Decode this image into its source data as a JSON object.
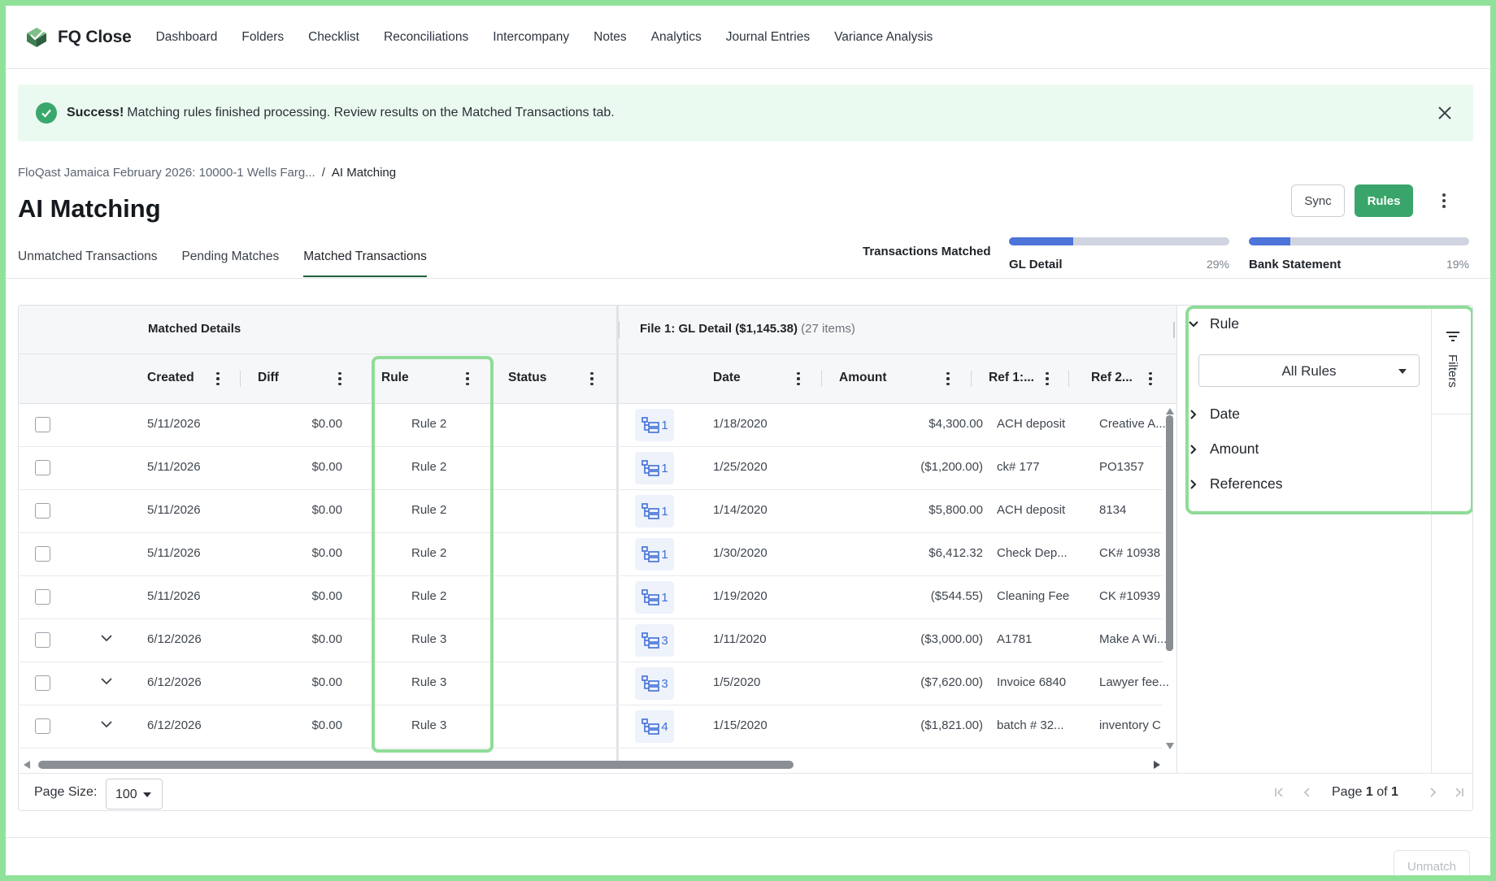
{
  "app": {
    "name": "FQ Close"
  },
  "nav": [
    "Dashboard",
    "Folders",
    "Checklist",
    "Reconciliations",
    "Intercompany",
    "Notes",
    "Analytics",
    "Journal Entries",
    "Variance Analysis"
  ],
  "banner": {
    "title": "Success!",
    "message": "Matching rules finished processing. Review results on the Matched Transactions tab."
  },
  "breadcrumb": {
    "parent": "FloQast Jamaica February 2026: 10000-1 Wells Farg...",
    "separator": "/",
    "current": "AI Matching"
  },
  "page_title": "AI Matching",
  "actions": {
    "sync": "Sync",
    "rules": "Rules"
  },
  "tabs": [
    "Unmatched Transactions",
    "Pending Matches",
    "Matched Transactions"
  ],
  "active_tab": 2,
  "progress": {
    "label": "Transactions Matched",
    "gl": {
      "name": "GL Detail",
      "percent_text": "29%",
      "value": 0.29
    },
    "bank": {
      "name": "Bank Statement",
      "percent_text": "19%",
      "value": 0.19
    }
  },
  "groups": {
    "matched": "Matched Details",
    "file_title": "File 1: GL Detail",
    "file_total": "($1,145.38)",
    "file_count": "(27 items)"
  },
  "columns": {
    "created": "Created",
    "diff": "Diff",
    "rule": "Rule",
    "status": "Status",
    "date": "Date",
    "amount": "Amount",
    "ref1": "Ref 1:...",
    "ref2": "Ref 2..."
  },
  "rows": [
    {
      "created": "5/11/2026",
      "diff": "$0.00",
      "rule": "Rule 2",
      "count": "1",
      "date": "1/18/2020",
      "amount": "$4,300.00",
      "ref1": "ACH deposit",
      "ref2": "Creative A...",
      "expandable": false
    },
    {
      "created": "5/11/2026",
      "diff": "$0.00",
      "rule": "Rule 2",
      "count": "1",
      "date": "1/25/2020",
      "amount": "($1,200.00)",
      "ref1": "ck# 177",
      "ref2": "PO1357",
      "expandable": false
    },
    {
      "created": "5/11/2026",
      "diff": "$0.00",
      "rule": "Rule 2",
      "count": "1",
      "date": "1/14/2020",
      "amount": "$5,800.00",
      "ref1": "ACH deposit",
      "ref2": "8134",
      "expandable": false
    },
    {
      "created": "5/11/2026",
      "diff": "$0.00",
      "rule": "Rule 2",
      "count": "1",
      "date": "1/30/2020",
      "amount": "$6,412.32",
      "ref1": "Check Dep...",
      "ref2": "CK# 10938",
      "expandable": false
    },
    {
      "created": "5/11/2026",
      "diff": "$0.00",
      "rule": "Rule 2",
      "count": "1",
      "date": "1/19/2020",
      "amount": "($544.55)",
      "ref1": "Cleaning Fee",
      "ref2": "CK #10939",
      "expandable": false
    },
    {
      "created": "6/12/2026",
      "diff": "$0.00",
      "rule": "Rule 3",
      "count": "3",
      "date": "1/11/2020",
      "amount": "($3,000.00)",
      "ref1": "A1781",
      "ref2": "Make A Wi...",
      "expandable": true
    },
    {
      "created": "6/12/2026",
      "diff": "$0.00",
      "rule": "Rule 3",
      "count": "3",
      "date": "1/5/2020",
      "amount": "($7,620.00)",
      "ref1": "Invoice 6840",
      "ref2": "Lawyer fee...",
      "expandable": true
    },
    {
      "created": "6/12/2026",
      "diff": "$0.00",
      "rule": "Rule 3",
      "count": "4",
      "date": "1/15/2020",
      "amount": "($1,821.00)",
      "ref1": "batch # 32...",
      "ref2": "inventory C",
      "expandable": true
    }
  ],
  "pagination": {
    "page_size_label": "Page Size:",
    "page_size": "100",
    "page_prefix": "Page",
    "page": "1",
    "of": "of",
    "total": "1"
  },
  "filters": {
    "tab_label": "Filters",
    "rule_section": "Rule",
    "rule_select": "All Rules",
    "sections": [
      "Date",
      "Amount",
      "References"
    ]
  },
  "footer_action": "Unmatch",
  "colors": {
    "accent_green": "#3aa56a",
    "progress_blue": "#4d74d9",
    "highlight": "#8fdc98",
    "success_bg": "#ebfaf1"
  }
}
